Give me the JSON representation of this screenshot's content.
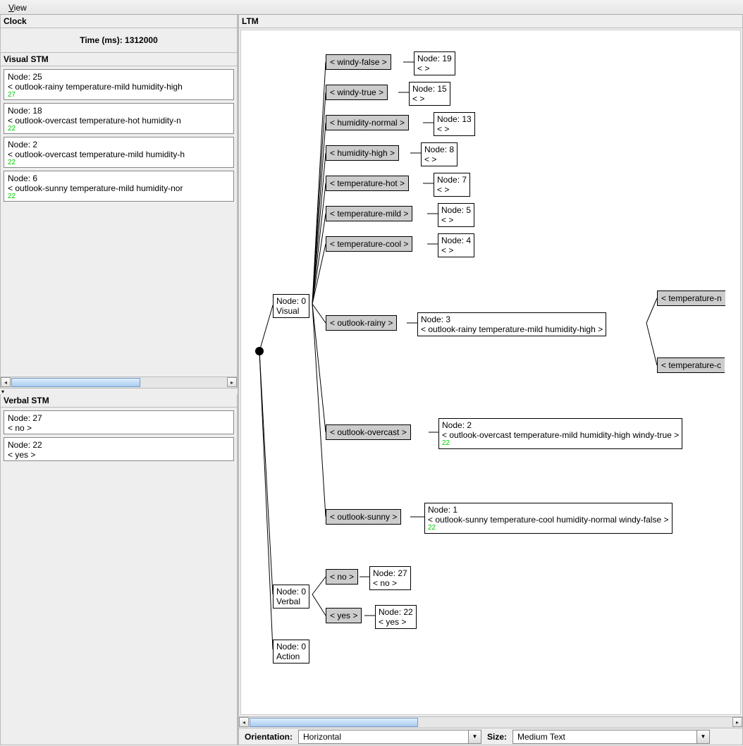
{
  "menubar": {
    "view": "View"
  },
  "clock": {
    "title": "Clock",
    "time_label": "Time (ms): 1312000"
  },
  "visual_stm": {
    "title": "Visual STM",
    "items": [
      {
        "line1": "Node: 25",
        "line2": "< outlook-rainy temperature-mild humidity-high",
        "anno": "27"
      },
      {
        "line1": "Node: 18",
        "line2": "< outlook-overcast temperature-hot humidity-n",
        "anno": "22"
      },
      {
        "line1": "Node: 2",
        "line2": "< outlook-overcast temperature-mild humidity-h",
        "anno": "22"
      },
      {
        "line1": "Node: 6",
        "line2": "< outlook-sunny temperature-mild humidity-nor",
        "anno": "22"
      }
    ]
  },
  "verbal_stm": {
    "title": "Verbal STM",
    "items": [
      {
        "line1": "Node: 27",
        "line2": "< no >"
      },
      {
        "line1": "Node: 22",
        "line2": "< yes >"
      }
    ]
  },
  "ltm": {
    "title": "LTM",
    "controls": {
      "orientation_label": "Orientation:",
      "orientation_value": "Horizontal",
      "size_label": "Size:",
      "size_value": "Medium Text"
    },
    "root_nodes": [
      {
        "line1": "Node: 0",
        "line2": "Visual"
      },
      {
        "line1": "Node: 0",
        "line2": "Verbal"
      },
      {
        "line1": "Node: 0",
        "line2": "Action"
      }
    ],
    "branches_visual_top": [
      {
        "label": "< windy-false >",
        "leaf_l1": "Node: 19",
        "leaf_l2": "< >"
      },
      {
        "label": "< windy-true >",
        "leaf_l1": "Node: 15",
        "leaf_l2": "< >"
      },
      {
        "label": "< humidity-normal >",
        "leaf_l1": "Node: 13",
        "leaf_l2": "< >"
      },
      {
        "label": "< humidity-high >",
        "leaf_l1": "Node: 8",
        "leaf_l2": "< >"
      },
      {
        "label": "< temperature-hot >",
        "leaf_l1": "Node: 7",
        "leaf_l2": "< >"
      },
      {
        "label": "< temperature-mild >",
        "leaf_l1": "Node: 5",
        "leaf_l2": "< >"
      },
      {
        "label": "< temperature-cool >",
        "leaf_l1": "Node: 4",
        "leaf_l2": "< >"
      }
    ],
    "branch_rainy": {
      "label": "< outlook-rainy >",
      "leaf_l1": "Node: 3",
      "leaf_l2": "< outlook-rainy temperature-mild humidity-high >",
      "sub_upper": "< temperature-n",
      "sub_lower": "< temperature-c"
    },
    "branch_overcast": {
      "label": "< outlook-overcast >",
      "leaf_l1": "Node: 2",
      "leaf_l2": "< outlook-overcast temperature-mild humidity-high windy-true >",
      "anno": "22"
    },
    "branch_sunny": {
      "label": "< outlook-sunny >",
      "leaf_l1": "Node: 1",
      "leaf_l2": "< outlook-sunny temperature-cool humidity-normal windy-false >",
      "anno": "22"
    },
    "branches_verbal": [
      {
        "label": "< no >",
        "leaf_l1": "Node: 27",
        "leaf_l2": "< no >"
      },
      {
        "label": "< yes >",
        "leaf_l1": "Node: 22",
        "leaf_l2": "< yes >"
      }
    ]
  }
}
